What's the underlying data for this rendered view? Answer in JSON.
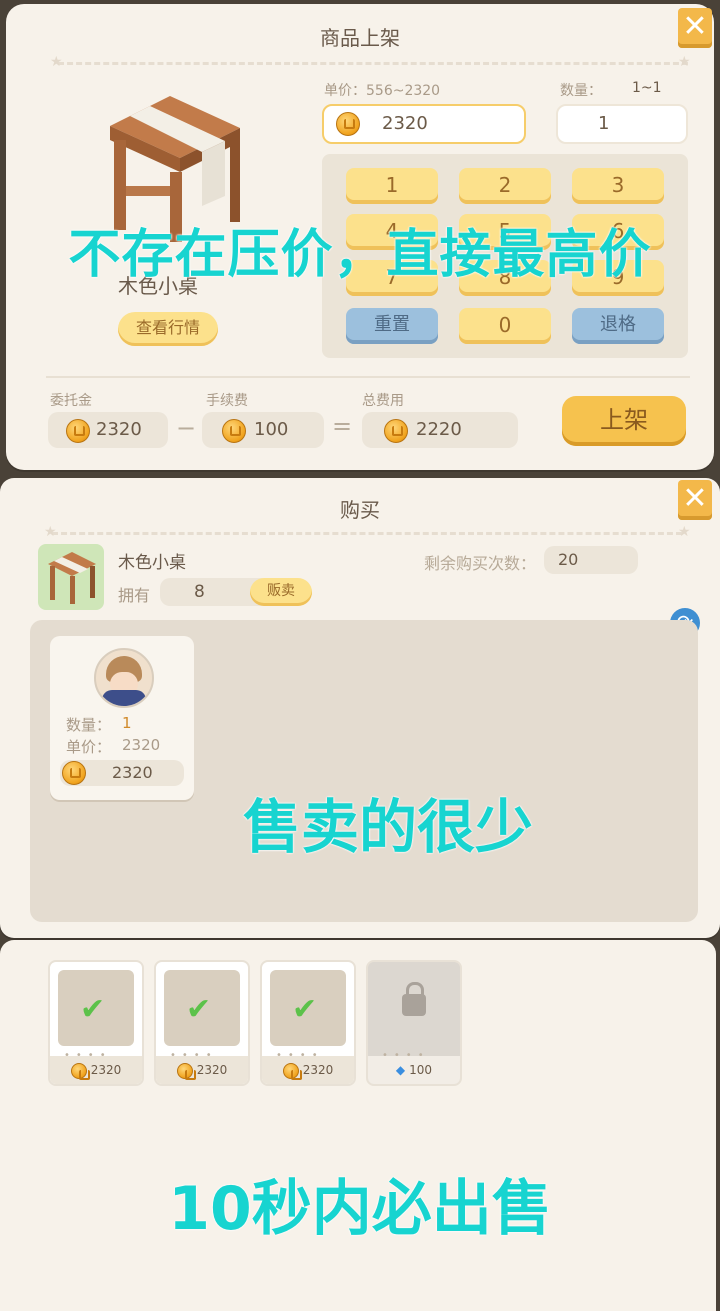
{
  "listing": {
    "title": "商品上架",
    "unit_price_label": "单价：556~2320",
    "price_value": "2320",
    "qty_label": "数量：",
    "qty_range": "1~1",
    "qty_value": "1",
    "item_name": "木色小桌",
    "market_button": "查看行情",
    "keys": [
      "1",
      "2",
      "3",
      "4",
      "5",
      "6",
      "7",
      "8",
      "9"
    ],
    "reset_key": "重置",
    "zero_key": "0",
    "back_key": "退格",
    "deposit_label": "委托金",
    "deposit_value": "2320",
    "fee_label": "手续费",
    "fee_value": "100",
    "total_label": "总费用",
    "total_value": "2220",
    "submit_button": "上架"
  },
  "overlay1": "不存在压价，直接最高价",
  "purchase": {
    "title": "购买",
    "item_name": "木色小桌",
    "owned_label": "拥有",
    "owned_value": "8",
    "sell_button": "贩卖",
    "remaining_label": "剩余购买次数：",
    "remaining_value": "20",
    "seller_qty_label": "数量：",
    "seller_qty_value": "1",
    "seller_price_label": "单价：",
    "seller_price_value": "2320",
    "seller_total": "2320"
  },
  "overlay2": "售卖的很少",
  "slots": [
    {
      "price": "2320",
      "sold": true
    },
    {
      "price": "2320",
      "sold": true
    },
    {
      "price": "2320",
      "sold": true
    },
    {
      "price": "100",
      "locked": true
    }
  ],
  "overlay3": "10秒内必出售",
  "colors": {
    "accent": "#f3b84a",
    "overlay": "#17d4d0",
    "key": "#fce18c",
    "key_blue": "#9cc0dd"
  }
}
